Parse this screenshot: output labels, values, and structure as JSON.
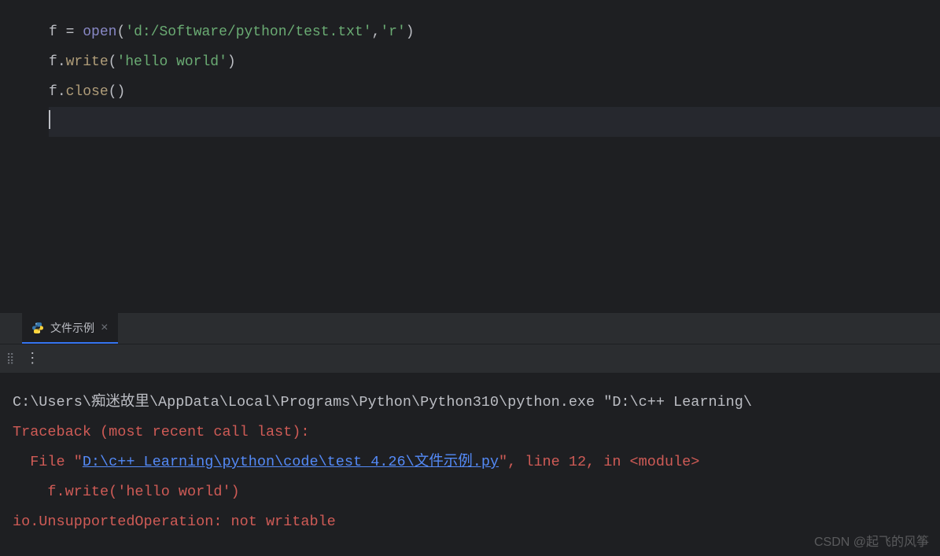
{
  "gutter": {
    "lines": [
      "",
      "",
      "",
      ""
    ]
  },
  "code": {
    "line1": {
      "var": "f",
      "sp1": " ",
      "op": "=",
      "sp2": " ",
      "fn": "open",
      "lp": "(",
      "arg1": "'d:/Software/python/test.txt'",
      "comma": ",",
      "arg2": "'r'",
      "rp": ")"
    },
    "line2": {
      "obj": "f",
      "dot": ".",
      "method": "write",
      "lp": "(",
      "arg": "'hello world'",
      "rp": ")"
    },
    "line3": {
      "obj": "f",
      "dot": ".",
      "method": "close",
      "lp": "(",
      "rp": ")"
    }
  },
  "tab": {
    "name": "文件示例"
  },
  "terminal": {
    "cmd_pre": "C:\\Users\\",
    "cmd_cn": "痴迷故里",
    "cmd_post": "\\AppData\\Local\\Programs\\Python\\Python310\\python.exe \"D:\\c++ Learning\\",
    "traceback": "Traceback (most recent call last):",
    "file_pre": "  File \"",
    "file_link": "D:\\c++ Learning\\python\\code\\test 4.26\\",
    "file_link_cn": "文件示例",
    "file_link_ext": ".py",
    "file_post": "\", line 12, in <module>",
    "code_line": "    f.write('hello world')",
    "error": "io.UnsupportedOperation: not writable"
  },
  "watermark": "CSDN @起飞的风筝"
}
